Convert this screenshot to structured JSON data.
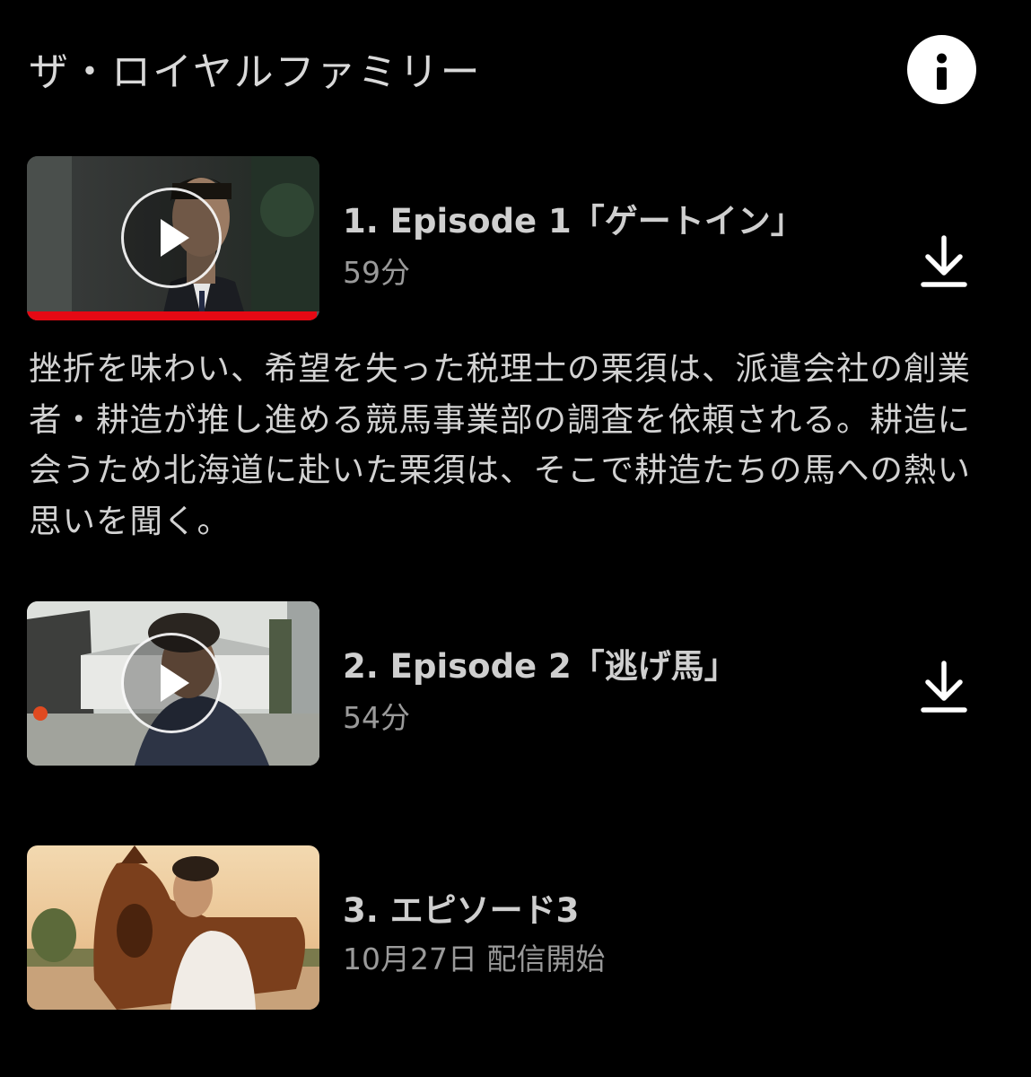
{
  "header": {
    "title": "ザ・ロイヤルファミリー",
    "info_icon": "info-icon"
  },
  "episodes": [
    {
      "number_title": "1. Episode 1「ゲートイン」",
      "subtext": "59分",
      "synopsis": "挫折を味わい、希望を失った税理士の栗須は、派遣会社の創業者・耕造が推し進める競馬事業部の調査を依頼される。耕造に会うため北海道に赴いた栗須は、そこで耕造たちの馬への熱い思いを聞く。",
      "watch_progress": 0.99,
      "has_download": true
    },
    {
      "number_title": "2. Episode 2「逃げ馬」",
      "subtext": "54分",
      "has_download": true
    },
    {
      "number_title": "3. エピソード3",
      "subtext": "10月27日 配信開始",
      "has_download": false
    }
  ],
  "colors": {
    "background": "#000000",
    "progress": "#e50914"
  }
}
